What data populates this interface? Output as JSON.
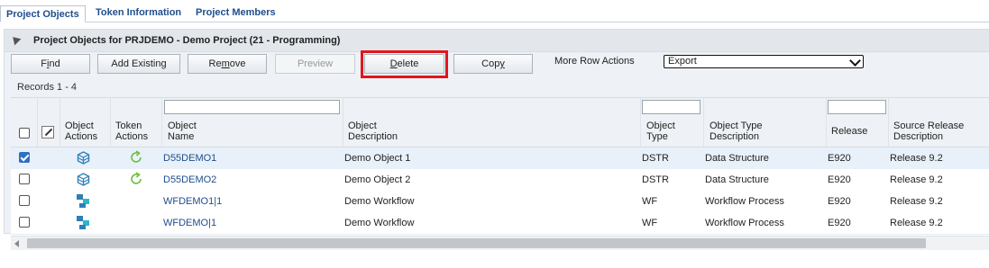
{
  "tabs": [
    {
      "label": "Project Objects",
      "active": true
    },
    {
      "label": "Token Information",
      "active": false
    },
    {
      "label": "Project Members",
      "active": false
    }
  ],
  "panel": {
    "title": "Project Objects for PRJDEMO - Demo Project  (21 - Programming)"
  },
  "toolbar": {
    "find": {
      "pre": "F",
      "u": "i",
      "post": "nd"
    },
    "add_existing": {
      "pre": "Add Existing",
      "u": "",
      "post": ""
    },
    "remove": {
      "pre": "Re",
      "u": "m",
      "post": "ove"
    },
    "preview": {
      "pre": "Preview",
      "u": "",
      "post": ""
    },
    "delete": {
      "pre": "",
      "u": "D",
      "post": "elete"
    },
    "copy": {
      "pre": "Cop",
      "u": "y",
      "post": ""
    },
    "more_row_actions_label": "More Row Actions",
    "more_row_actions_value": "Export"
  },
  "records_text": "Records 1 - 4",
  "columns": {
    "object_actions": [
      "Object",
      "Actions"
    ],
    "token_actions": [
      "Token",
      "Actions"
    ],
    "object_name": [
      "Object",
      "Name"
    ],
    "object_description": [
      "Object",
      "Description"
    ],
    "object_type": [
      "Object",
      "Type"
    ],
    "object_type_description": [
      "Object Type",
      "Description"
    ],
    "release": [
      "Release",
      ""
    ],
    "source_release_description": [
      "Source Release",
      "Description"
    ]
  },
  "rows": [
    {
      "selected": true,
      "icon": "data-structure-icon",
      "token": "refresh-icon",
      "name": "D55DEMO1",
      "description": "Demo Object 1",
      "type": "DSTR",
      "type_description": "Data Structure",
      "release": "E920",
      "source_release": "Release 9.2"
    },
    {
      "selected": false,
      "icon": "data-structure-icon",
      "token": "refresh-icon",
      "name": "D55DEMO2",
      "description": "Demo Object 2",
      "type": "DSTR",
      "type_description": "Data Structure",
      "release": "E920",
      "source_release": "Release 9.2"
    },
    {
      "selected": false,
      "icon": "workflow-icon",
      "token": "",
      "name": "WFDEMO1|1",
      "description": "Demo Workflow",
      "type": "WF",
      "type_description": "Workflow Process",
      "release": "E920",
      "source_release": "Release 9.2"
    },
    {
      "selected": false,
      "icon": "workflow-icon",
      "token": "",
      "name": "WFDEMO|1",
      "description": "Demo Workflow",
      "type": "WF",
      "type_description": "Workflow Process",
      "release": "E920",
      "source_release": "Release 9.2"
    }
  ],
  "colors": {
    "link": "#1f4e8c",
    "highlight": "#e0161b",
    "icon_blue": "#2e7fb8",
    "icon_green": "#6abf3a"
  }
}
